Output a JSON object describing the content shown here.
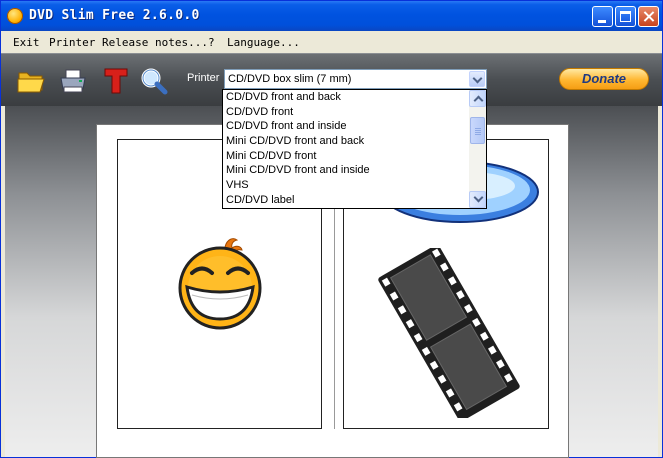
{
  "window": {
    "title": "DVD Slim Free 2.6.0.0"
  },
  "menu": {
    "items": [
      {
        "label": "Exit"
      },
      {
        "label": "Printer"
      },
      {
        "label": "Release notes..."
      },
      {
        "label": "?"
      },
      {
        "label": "Language..."
      }
    ]
  },
  "toolbar": {
    "icons": [
      "open-folder-icon",
      "print-icon",
      "text-icon",
      "zoom-icon"
    ],
    "printer_label": "Printer",
    "template_select_value": "CD/DVD box slim (7 mm)",
    "donate_label": "Donate"
  },
  "template_dropdown": {
    "items": [
      {
        "label": "CD/DVD front and back",
        "selected": false
      },
      {
        "label": "CD/DVD front",
        "selected": false
      },
      {
        "label": "CD/DVD front and inside",
        "selected": false
      },
      {
        "label": "Mini CD/DVD front and back",
        "selected": false
      },
      {
        "label": "Mini CD/DVD front",
        "selected": false
      },
      {
        "label": "Mini CD/DVD front and inside",
        "selected": false
      },
      {
        "label": "VHS",
        "selected": false
      },
      {
        "label": "CD/DVD label",
        "selected": false
      }
    ]
  },
  "preview": {
    "images": [
      "smiley-face-image",
      "disc-image",
      "film-strip-image"
    ]
  },
  "colors": {
    "titlebar": "#0053e0",
    "selection": "#316ac5",
    "donate": "#ffb731"
  }
}
